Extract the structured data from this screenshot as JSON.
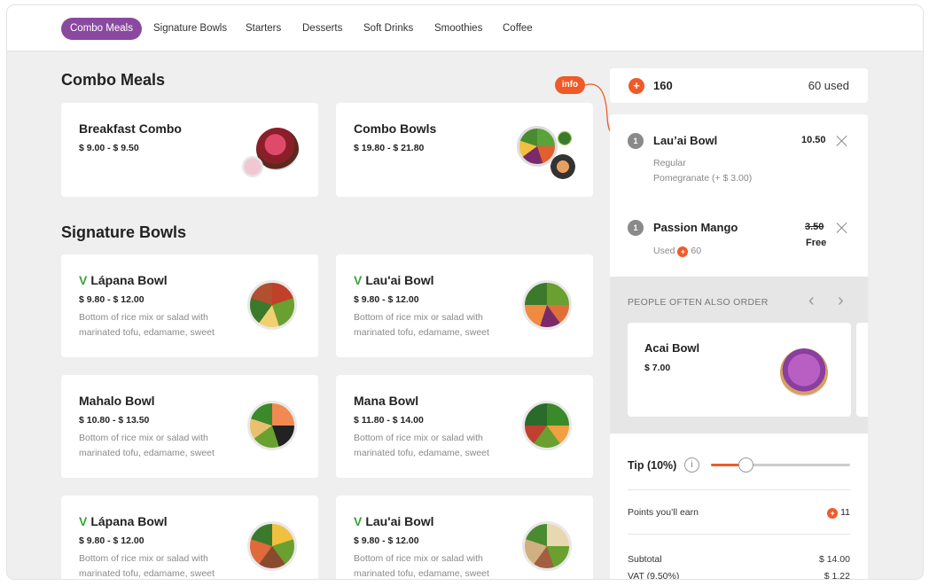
{
  "nav": {
    "tabs": [
      {
        "label": "Combo Meals",
        "active": true
      },
      {
        "label": "Signature Bowls"
      },
      {
        "label": "Starters"
      },
      {
        "label": "Desserts"
      },
      {
        "label": "Soft Drinks"
      },
      {
        "label": "Smoothies"
      },
      {
        "label": "Coffee"
      }
    ]
  },
  "sections": {
    "combo": {
      "title": "Combo Meals",
      "items": [
        {
          "name": "Breakfast Combo",
          "price": "$ 9.00 - $ 9.50"
        },
        {
          "name": "Combo Bowls",
          "price": "$ 19.80 - $ 21.80"
        }
      ]
    },
    "signature": {
      "title": "Signature Bowls",
      "items": [
        {
          "name": "Lápana Bowl",
          "price": "$ 9.80 - $ 12.00",
          "desc": "Bottom of rice mix or salad with marinated tofu, edamame, sweet",
          "vegan": true
        },
        {
          "name": "Lau'ai Bowl",
          "price": "$ 9.80 - $ 12.00",
          "desc": "Bottom of rice mix or salad with marinated tofu, edamame, sweet",
          "vegan": true
        },
        {
          "name": "Mahalo Bowl",
          "price": "$ 10.80 - $ 13.50",
          "desc": "Bottom of rice mix or salad with marinated tofu, edamame, sweet"
        },
        {
          "name": "Mana Bowl",
          "price": "$ 11.80 - $ 14.00",
          "desc": "Bottom of rice mix or salad with marinated tofu, edamame, sweet"
        },
        {
          "name": "Lápana Bowl",
          "price": "$ 9.80 - $ 12.00",
          "desc": "Bottom of rice mix or salad with marinated tofu, edamame, sweet",
          "vegan": true
        },
        {
          "name": "Lau'ai Bowl",
          "price": "$ 9.80 - $ 12.00",
          "desc": "Bottom of rice mix or salad with marinated tofu, edamame, sweet",
          "vegan": true
        }
      ],
      "vegan_mark": "V"
    }
  },
  "info_badge": "info",
  "points": {
    "balance": "160",
    "used": "60 used",
    "icon": "+"
  },
  "cart": {
    "items": [
      {
        "qty": "1",
        "name": "Lau’ai Bowl",
        "price": "10.50",
        "option1": "Regular",
        "option2": "Pomegranate (+ $ 3.00)"
      },
      {
        "qty": "1",
        "name": "Passion Mango",
        "price_old": "3.50",
        "price": "Free",
        "used_label": "Used",
        "used_points": "60"
      }
    ]
  },
  "also_order": {
    "title": "PEOPLE OFTEN ALSO ORDER",
    "prev": "‹",
    "next": "›",
    "items": [
      {
        "name": "Acai Bowl",
        "price": "$ 7.00"
      }
    ]
  },
  "tip": {
    "label": "Tip (10%)",
    "info_icon": "i",
    "value": 0.25
  },
  "earn": {
    "label": "Points you’ll earn",
    "value": "11"
  },
  "totals": {
    "subtotal_label": "Subtotal",
    "subtotal": "$ 14.00",
    "vat_label": "VAT (9.50%)",
    "vat": "$ 1.22"
  },
  "colors": {
    "accent": "#8a49a1",
    "points": "#f05a28"
  }
}
